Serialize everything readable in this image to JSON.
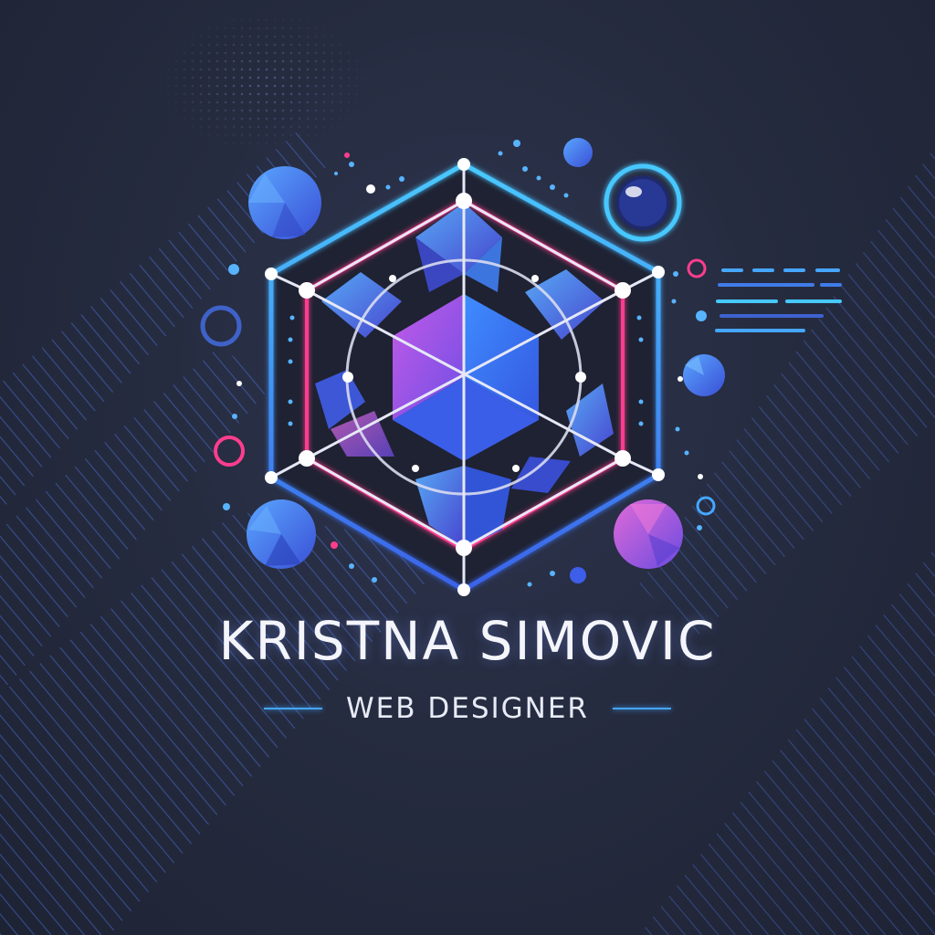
{
  "logo": {
    "name": "KRISTNA SIMOVIC",
    "tagline": "WEB DESIGNER"
  },
  "colors": {
    "background": "#262c40",
    "accent_cyan": "#46c8ff",
    "accent_blue": "#3f63e6",
    "accent_pink": "#ff3d8f",
    "accent_purple": "#a24ee8",
    "text": "#f4f5fb"
  },
  "icons": [
    "hexagon-network-emblem",
    "faceted-sphere",
    "lens-orb",
    "ring",
    "speed-lines"
  ]
}
